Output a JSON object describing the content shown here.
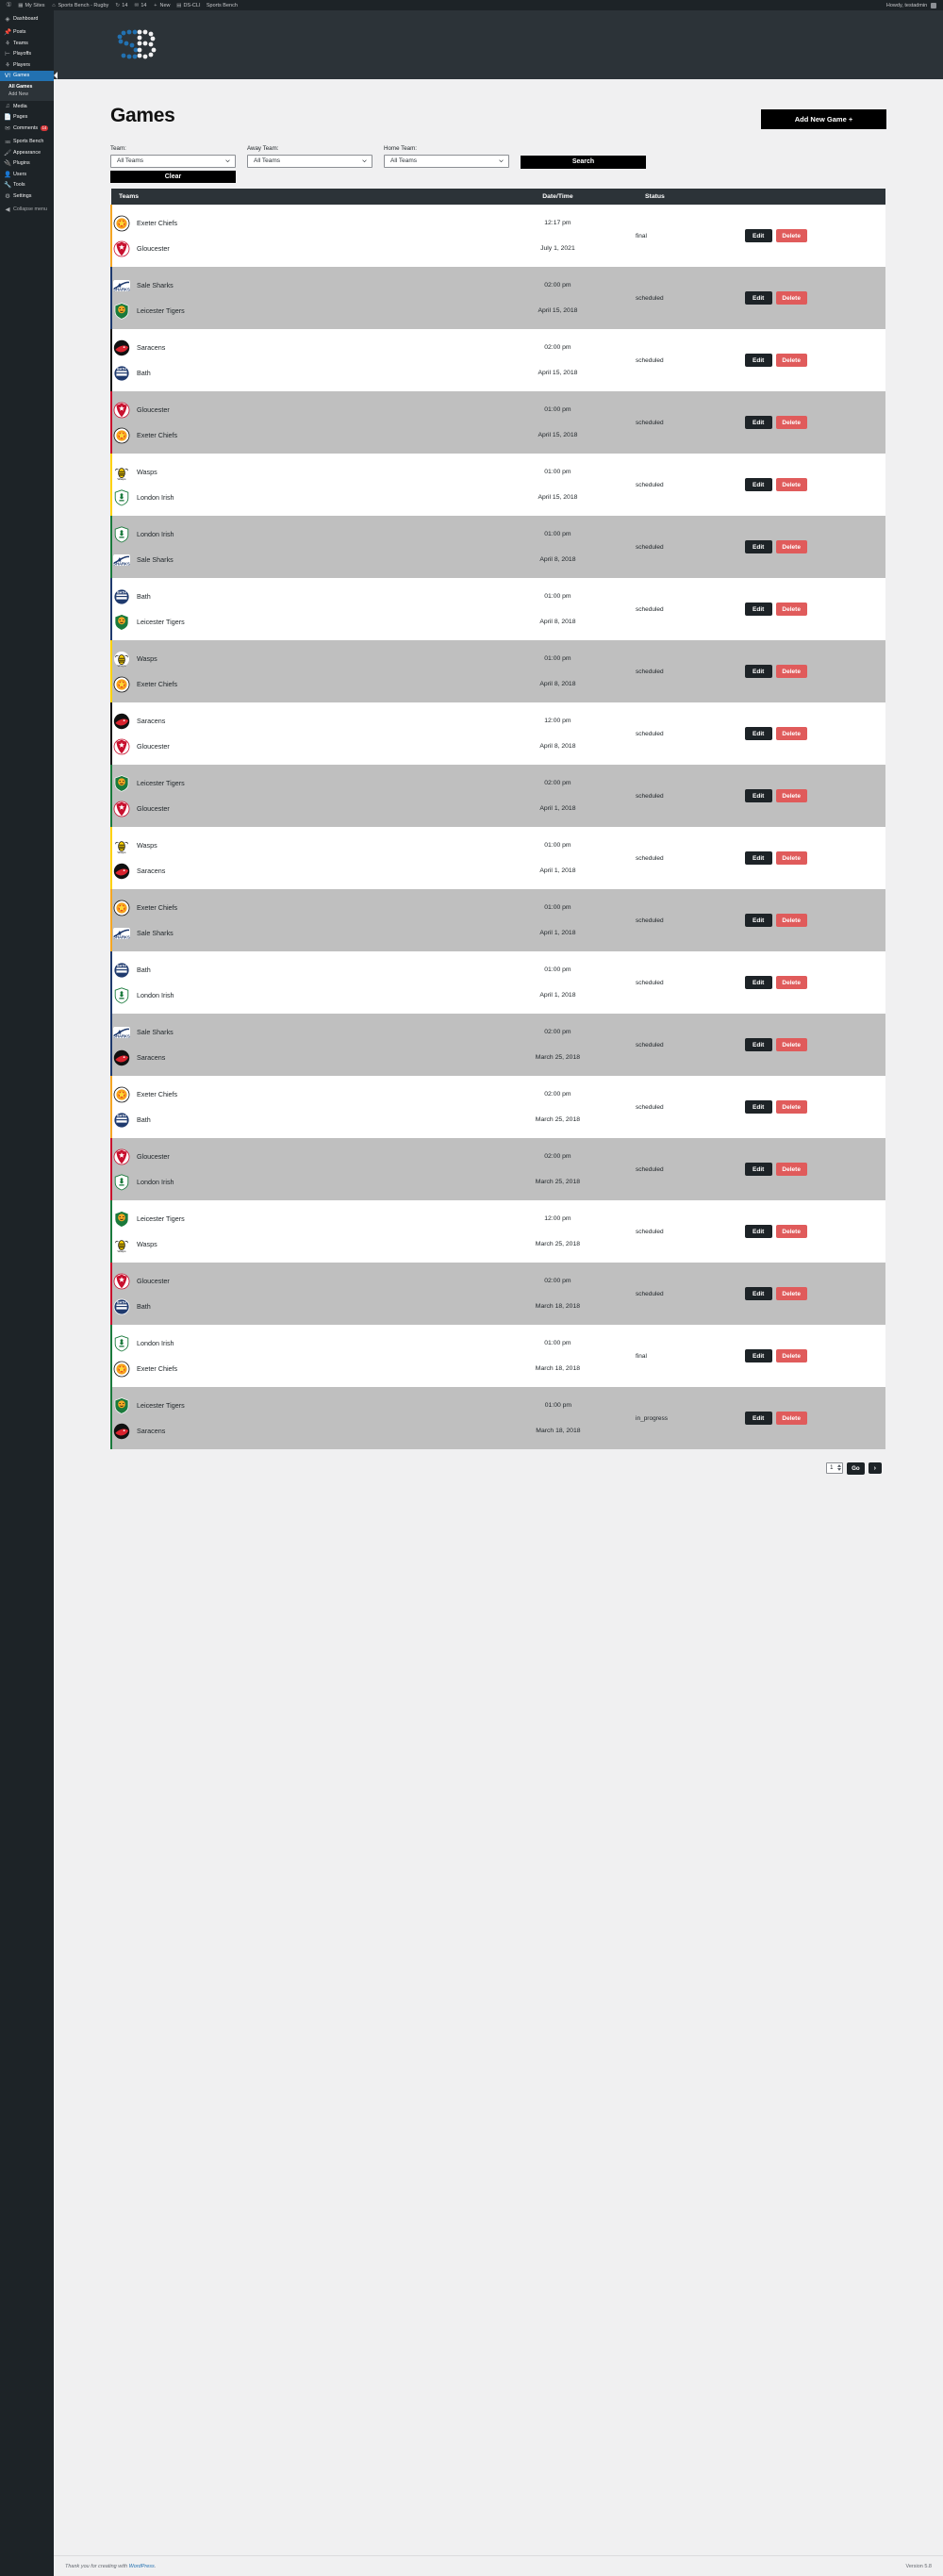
{
  "adminbar": {
    "left_items": [
      {
        "icon": "wordpress-logo-icon",
        "label": ""
      },
      {
        "icon": "my-sites-icon",
        "label": "My Sites"
      },
      {
        "icon": "home-icon",
        "label": "Sports Bench - Rugby"
      },
      {
        "icon": "update-icon",
        "label": "14"
      },
      {
        "icon": "comment-icon",
        "label": "14"
      },
      {
        "icon": "plus-icon",
        "label": "New"
      },
      {
        "icon": "ds-cli-icon",
        "label": "DS-CLI"
      },
      {
        "icon": "",
        "label": "Sports Bench"
      }
    ],
    "howdy": "Howdy, testadmin"
  },
  "sidebar": {
    "items": [
      {
        "label": "Dashboard",
        "icon": "dashboard-icon",
        "current": false
      },
      {
        "label": "Posts",
        "icon": "pin-icon",
        "current": false
      },
      {
        "label": "Teams",
        "icon": "teams-icon",
        "current": false
      },
      {
        "label": "Playoffs",
        "icon": "playoffs-icon",
        "current": false
      },
      {
        "label": "Players",
        "icon": "players-icon",
        "current": false
      },
      {
        "label": "Games",
        "icon": "games-icon",
        "current": true
      },
      {
        "label": "Media",
        "icon": "media-icon",
        "current": false
      },
      {
        "label": "Pages",
        "icon": "pages-icon",
        "current": false
      },
      {
        "label": "Comments",
        "icon": "comments-icon",
        "current": false,
        "badge": "14"
      },
      {
        "label": "Sports Bench",
        "icon": "sports-bench-icon",
        "current": false
      },
      {
        "label": "Appearance",
        "icon": "appearance-icon",
        "current": false
      },
      {
        "label": "Plugins",
        "icon": "plugins-icon",
        "current": false
      },
      {
        "label": "Users",
        "icon": "users-icon",
        "current": false
      },
      {
        "label": "Tools",
        "icon": "tools-icon",
        "current": false
      },
      {
        "label": "Settings",
        "icon": "settings-icon",
        "current": false
      }
    ],
    "submenu": [
      {
        "label": "All Games",
        "current": true
      },
      {
        "label": "Add New",
        "current": false
      }
    ],
    "collapse": "Collapse menu"
  },
  "page": {
    "title": "Games",
    "add_button": "Add New Game +"
  },
  "filters": {
    "team": {
      "label": "Team:",
      "value": "All Teams"
    },
    "away_team": {
      "label": "Away Team:",
      "value": "All Teams"
    },
    "home_team": {
      "label": "Home Team:",
      "value": "All Teams"
    },
    "search_button": "Search",
    "clear_button": "Clear"
  },
  "table": {
    "columns": [
      "Teams",
      "Date/Time",
      "Status",
      ""
    ],
    "edit_label": "Edit",
    "delete_label": "Delete",
    "rows": [
      {
        "away": "Exeter Chiefs",
        "away_logo": "exeter-chiefs-logo",
        "home": "Gloucester",
        "home_logo": "gloucester-logo",
        "time": "12:17 pm",
        "date": "July 1, 2021",
        "status": "final",
        "bar": "#f5a623"
      },
      {
        "away": "Sale Sharks",
        "away_logo": "sale-sharks-logo",
        "home": "Leicester Tigers",
        "home_logo": "leicester-tigers-logo",
        "time": "02:00 pm",
        "date": "April 15, 2018",
        "status": "scheduled",
        "bar": "#1f3a6e"
      },
      {
        "away": "Saracens",
        "away_logo": "saracens-logo",
        "home": "Bath",
        "home_logo": "bath-logo",
        "time": "02:00 pm",
        "date": "April 15, 2018",
        "status": "scheduled",
        "bar": "#111111"
      },
      {
        "away": "Gloucester",
        "away_logo": "gloucester-logo",
        "home": "Exeter Chiefs",
        "home_logo": "exeter-chiefs-logo",
        "time": "01:00 pm",
        "date": "April 15, 2018",
        "status": "scheduled",
        "bar": "#c8102e"
      },
      {
        "away": "Wasps",
        "away_logo": "wasps-logo",
        "home": "London Irish",
        "home_logo": "london-irish-logo",
        "time": "01:00 pm",
        "date": "April 15, 2018",
        "status": "scheduled",
        "bar": "#ffd200"
      },
      {
        "away": "London Irish",
        "away_logo": "london-irish-logo",
        "home": "Sale Sharks",
        "home_logo": "sale-sharks-logo",
        "time": "01:00 pm",
        "date": "April 8, 2018",
        "status": "scheduled",
        "bar": "#1a7a3c"
      },
      {
        "away": "Bath",
        "away_logo": "bath-logo",
        "home": "Leicester Tigers",
        "home_logo": "leicester-tigers-logo",
        "time": "01:00 pm",
        "date": "April 8, 2018",
        "status": "scheduled",
        "bar": "#1f3a6e"
      },
      {
        "away": "Wasps",
        "away_logo": "wasps-logo",
        "home": "Exeter Chiefs",
        "home_logo": "exeter-chiefs-logo",
        "time": "01:00 pm",
        "date": "April 8, 2018",
        "status": "scheduled",
        "bar": "#ffd200"
      },
      {
        "away": "Saracens",
        "away_logo": "saracens-logo",
        "home": "Gloucester",
        "home_logo": "gloucester-logo",
        "time": "12:00 pm",
        "date": "April 8, 2018",
        "status": "scheduled",
        "bar": "#111111"
      },
      {
        "away": "Leicester Tigers",
        "away_logo": "leicester-tigers-logo",
        "home": "Gloucester",
        "home_logo": "gloucester-logo",
        "time": "02:00 pm",
        "date": "April 1, 2018",
        "status": "scheduled",
        "bar": "#1a7a3c"
      },
      {
        "away": "Wasps",
        "away_logo": "wasps-logo",
        "home": "Saracens",
        "home_logo": "saracens-logo",
        "time": "01:00 pm",
        "date": "April 1, 2018",
        "status": "scheduled",
        "bar": "#ffd200"
      },
      {
        "away": "Exeter Chiefs",
        "away_logo": "exeter-chiefs-logo",
        "home": "Sale Sharks",
        "home_logo": "sale-sharks-logo",
        "time": "01:00 pm",
        "date": "April 1, 2018",
        "status": "scheduled",
        "bar": "#f5a623"
      },
      {
        "away": "Bath",
        "away_logo": "bath-logo",
        "home": "London Irish",
        "home_logo": "london-irish-logo",
        "time": "01:00 pm",
        "date": "April 1, 2018",
        "status": "scheduled",
        "bar": "#1f3a6e"
      },
      {
        "away": "Sale Sharks",
        "away_logo": "sale-sharks-logo",
        "home": "Saracens",
        "home_logo": "saracens-logo",
        "time": "02:00 pm",
        "date": "March 25, 2018",
        "status": "scheduled",
        "bar": "#1f3a6e"
      },
      {
        "away": "Exeter Chiefs",
        "away_logo": "exeter-chiefs-logo",
        "home": "Bath",
        "home_logo": "bath-logo",
        "time": "02:00 pm",
        "date": "March 25, 2018",
        "status": "scheduled",
        "bar": "#f5a623"
      },
      {
        "away": "Gloucester",
        "away_logo": "gloucester-logo",
        "home": "London Irish",
        "home_logo": "london-irish-logo",
        "time": "02:00 pm",
        "date": "March 25, 2018",
        "status": "scheduled",
        "bar": "#c8102e"
      },
      {
        "away": "Leicester Tigers",
        "away_logo": "leicester-tigers-logo",
        "home": "Wasps",
        "home_logo": "wasps-logo",
        "time": "12:00 pm",
        "date": "March 25, 2018",
        "status": "scheduled",
        "bar": "#1a7a3c"
      },
      {
        "away": "Gloucester",
        "away_logo": "gloucester-logo",
        "home": "Bath",
        "home_logo": "bath-logo",
        "time": "02:00 pm",
        "date": "March 18, 2018",
        "status": "scheduled",
        "bar": "#c8102e"
      },
      {
        "away": "London Irish",
        "away_logo": "london-irish-logo",
        "home": "Exeter Chiefs",
        "home_logo": "exeter-chiefs-logo",
        "time": "01:00 pm",
        "date": "March 18, 2018",
        "status": "final",
        "bar": "#1a7a3c"
      },
      {
        "away": "Leicester Tigers",
        "away_logo": "leicester-tigers-logo",
        "home": "Saracens",
        "home_logo": "saracens-logo",
        "time": "01:00 pm",
        "date": "March 18, 2018",
        "status": "in_progress",
        "bar": "#1a7a3c"
      }
    ]
  },
  "pagination": {
    "page_value": "1",
    "go_label": "Go",
    "next_label": "›"
  },
  "footer": {
    "thanks_prefix": "Thank you for creating with ",
    "wordpress_link": "WordPress",
    "thanks_suffix": ".",
    "version": "Version 5.8"
  }
}
